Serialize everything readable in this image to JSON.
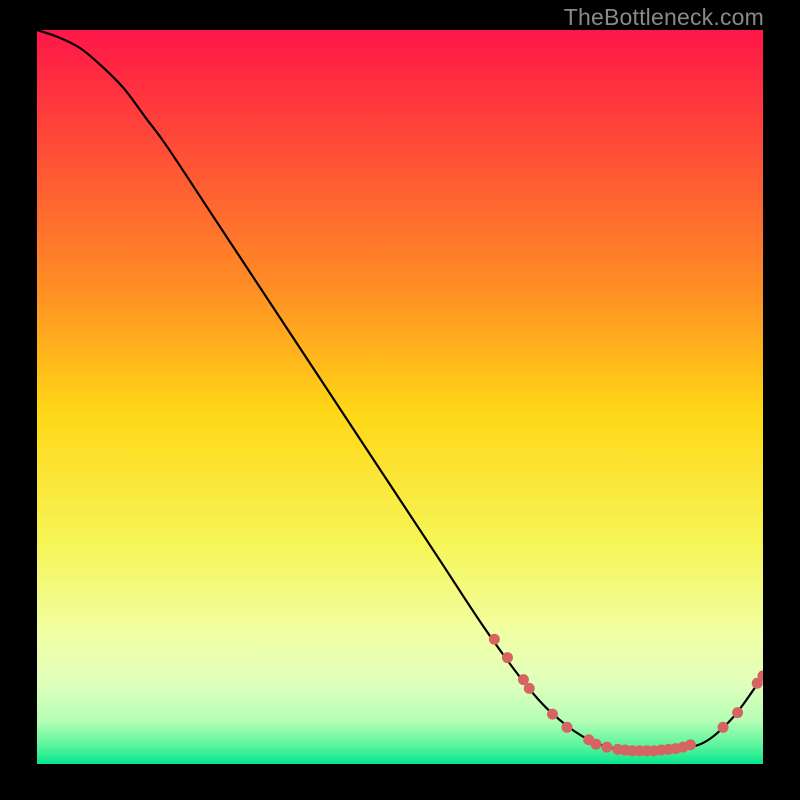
{
  "attribution": "TheBottleneck.com",
  "chart_data": {
    "type": "line",
    "title": "",
    "xlabel": "",
    "ylabel": "",
    "xlim": [
      0,
      100
    ],
    "ylim": [
      0,
      100
    ],
    "background_gradient": {
      "stops": [
        {
          "offset": 0.0,
          "color": "#ff1648"
        },
        {
          "offset": 0.35,
          "color": "#ff8d24"
        },
        {
          "offset": 0.52,
          "color": "#ffd716"
        },
        {
          "offset": 0.7,
          "color": "#f6f557"
        },
        {
          "offset": 0.82,
          "color": "#f1ffa3"
        },
        {
          "offset": 0.89,
          "color": "#e0ffbc"
        },
        {
          "offset": 0.94,
          "color": "#b6ffb6"
        },
        {
          "offset": 0.975,
          "color": "#5bf59d"
        },
        {
          "offset": 1.0,
          "color": "#06e58d"
        }
      ]
    },
    "curve": {
      "x": [
        0,
        3,
        6,
        9,
        12,
        15,
        18,
        25,
        35,
        45,
        55,
        62,
        68,
        72,
        76,
        80,
        84,
        88,
        92,
        96,
        100
      ],
      "y": [
        100,
        99,
        97.5,
        95,
        92,
        88,
        84,
        73.5,
        58.5,
        43.5,
        28.5,
        18,
        10,
        6,
        3.3,
        2,
        1.8,
        2,
        3,
        6.5,
        12
      ]
    },
    "markers": [
      {
        "x": 63.0,
        "y": 17.0
      },
      {
        "x": 64.8,
        "y": 14.5
      },
      {
        "x": 67.0,
        "y": 11.5
      },
      {
        "x": 67.8,
        "y": 10.3
      },
      {
        "x": 71.0,
        "y": 6.8
      },
      {
        "x": 73.0,
        "y": 5.0
      },
      {
        "x": 76.0,
        "y": 3.3
      },
      {
        "x": 77.0,
        "y": 2.7
      },
      {
        "x": 78.5,
        "y": 2.3
      },
      {
        "x": 80.0,
        "y": 2.0
      },
      {
        "x": 81.0,
        "y": 1.9
      },
      {
        "x": 82.0,
        "y": 1.8
      },
      {
        "x": 83.0,
        "y": 1.8
      },
      {
        "x": 84.0,
        "y": 1.8
      },
      {
        "x": 85.0,
        "y": 1.8
      },
      {
        "x": 86.0,
        "y": 1.9
      },
      {
        "x": 87.0,
        "y": 2.0
      },
      {
        "x": 88.0,
        "y": 2.1
      },
      {
        "x": 89.0,
        "y": 2.3
      },
      {
        "x": 90.0,
        "y": 2.6
      },
      {
        "x": 94.5,
        "y": 5.0
      },
      {
        "x": 96.5,
        "y": 7.0
      },
      {
        "x": 99.2,
        "y": 11.0
      },
      {
        "x": 100.0,
        "y": 12.0
      }
    ],
    "marker_color": "#d66461",
    "curve_color": "#000000"
  }
}
